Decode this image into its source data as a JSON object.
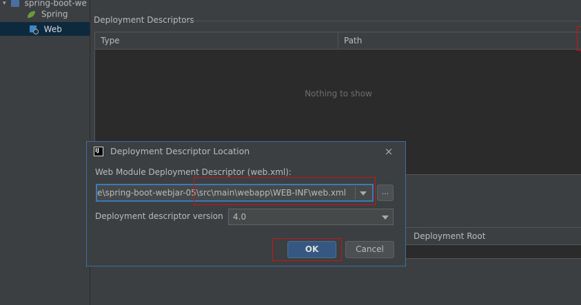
{
  "tree": {
    "items": [
      {
        "label": "spring-boot-we",
        "icon": "module-icon"
      },
      {
        "label": "Spring",
        "icon": "spring-leaf-icon"
      },
      {
        "label": "Web",
        "icon": "web-facet-icon"
      }
    ]
  },
  "descriptors": {
    "title": "Deployment Descriptors",
    "columns": [
      "Type",
      "Path"
    ],
    "empty_text": "Nothing to show"
  },
  "resources": {
    "column": "Deployment Root"
  },
  "dialog": {
    "title": "Deployment Descriptor Location",
    "app_icon_text": "IJ",
    "web_xml_label": "Web Module Deployment Descriptor (web.xml):",
    "path_value": ":e\\spring-boot-webjar-05\\src\\main\\webapp\\WEB-INF\\web.xml",
    "browse_label": "...",
    "version_label": "Deployment descriptor version",
    "version_value": "4.0",
    "ok_label": "OK",
    "cancel_label": "Cancel"
  },
  "colors": {
    "accent": "#365880",
    "highlight": "#c4161c",
    "background": "#3c3f41"
  }
}
